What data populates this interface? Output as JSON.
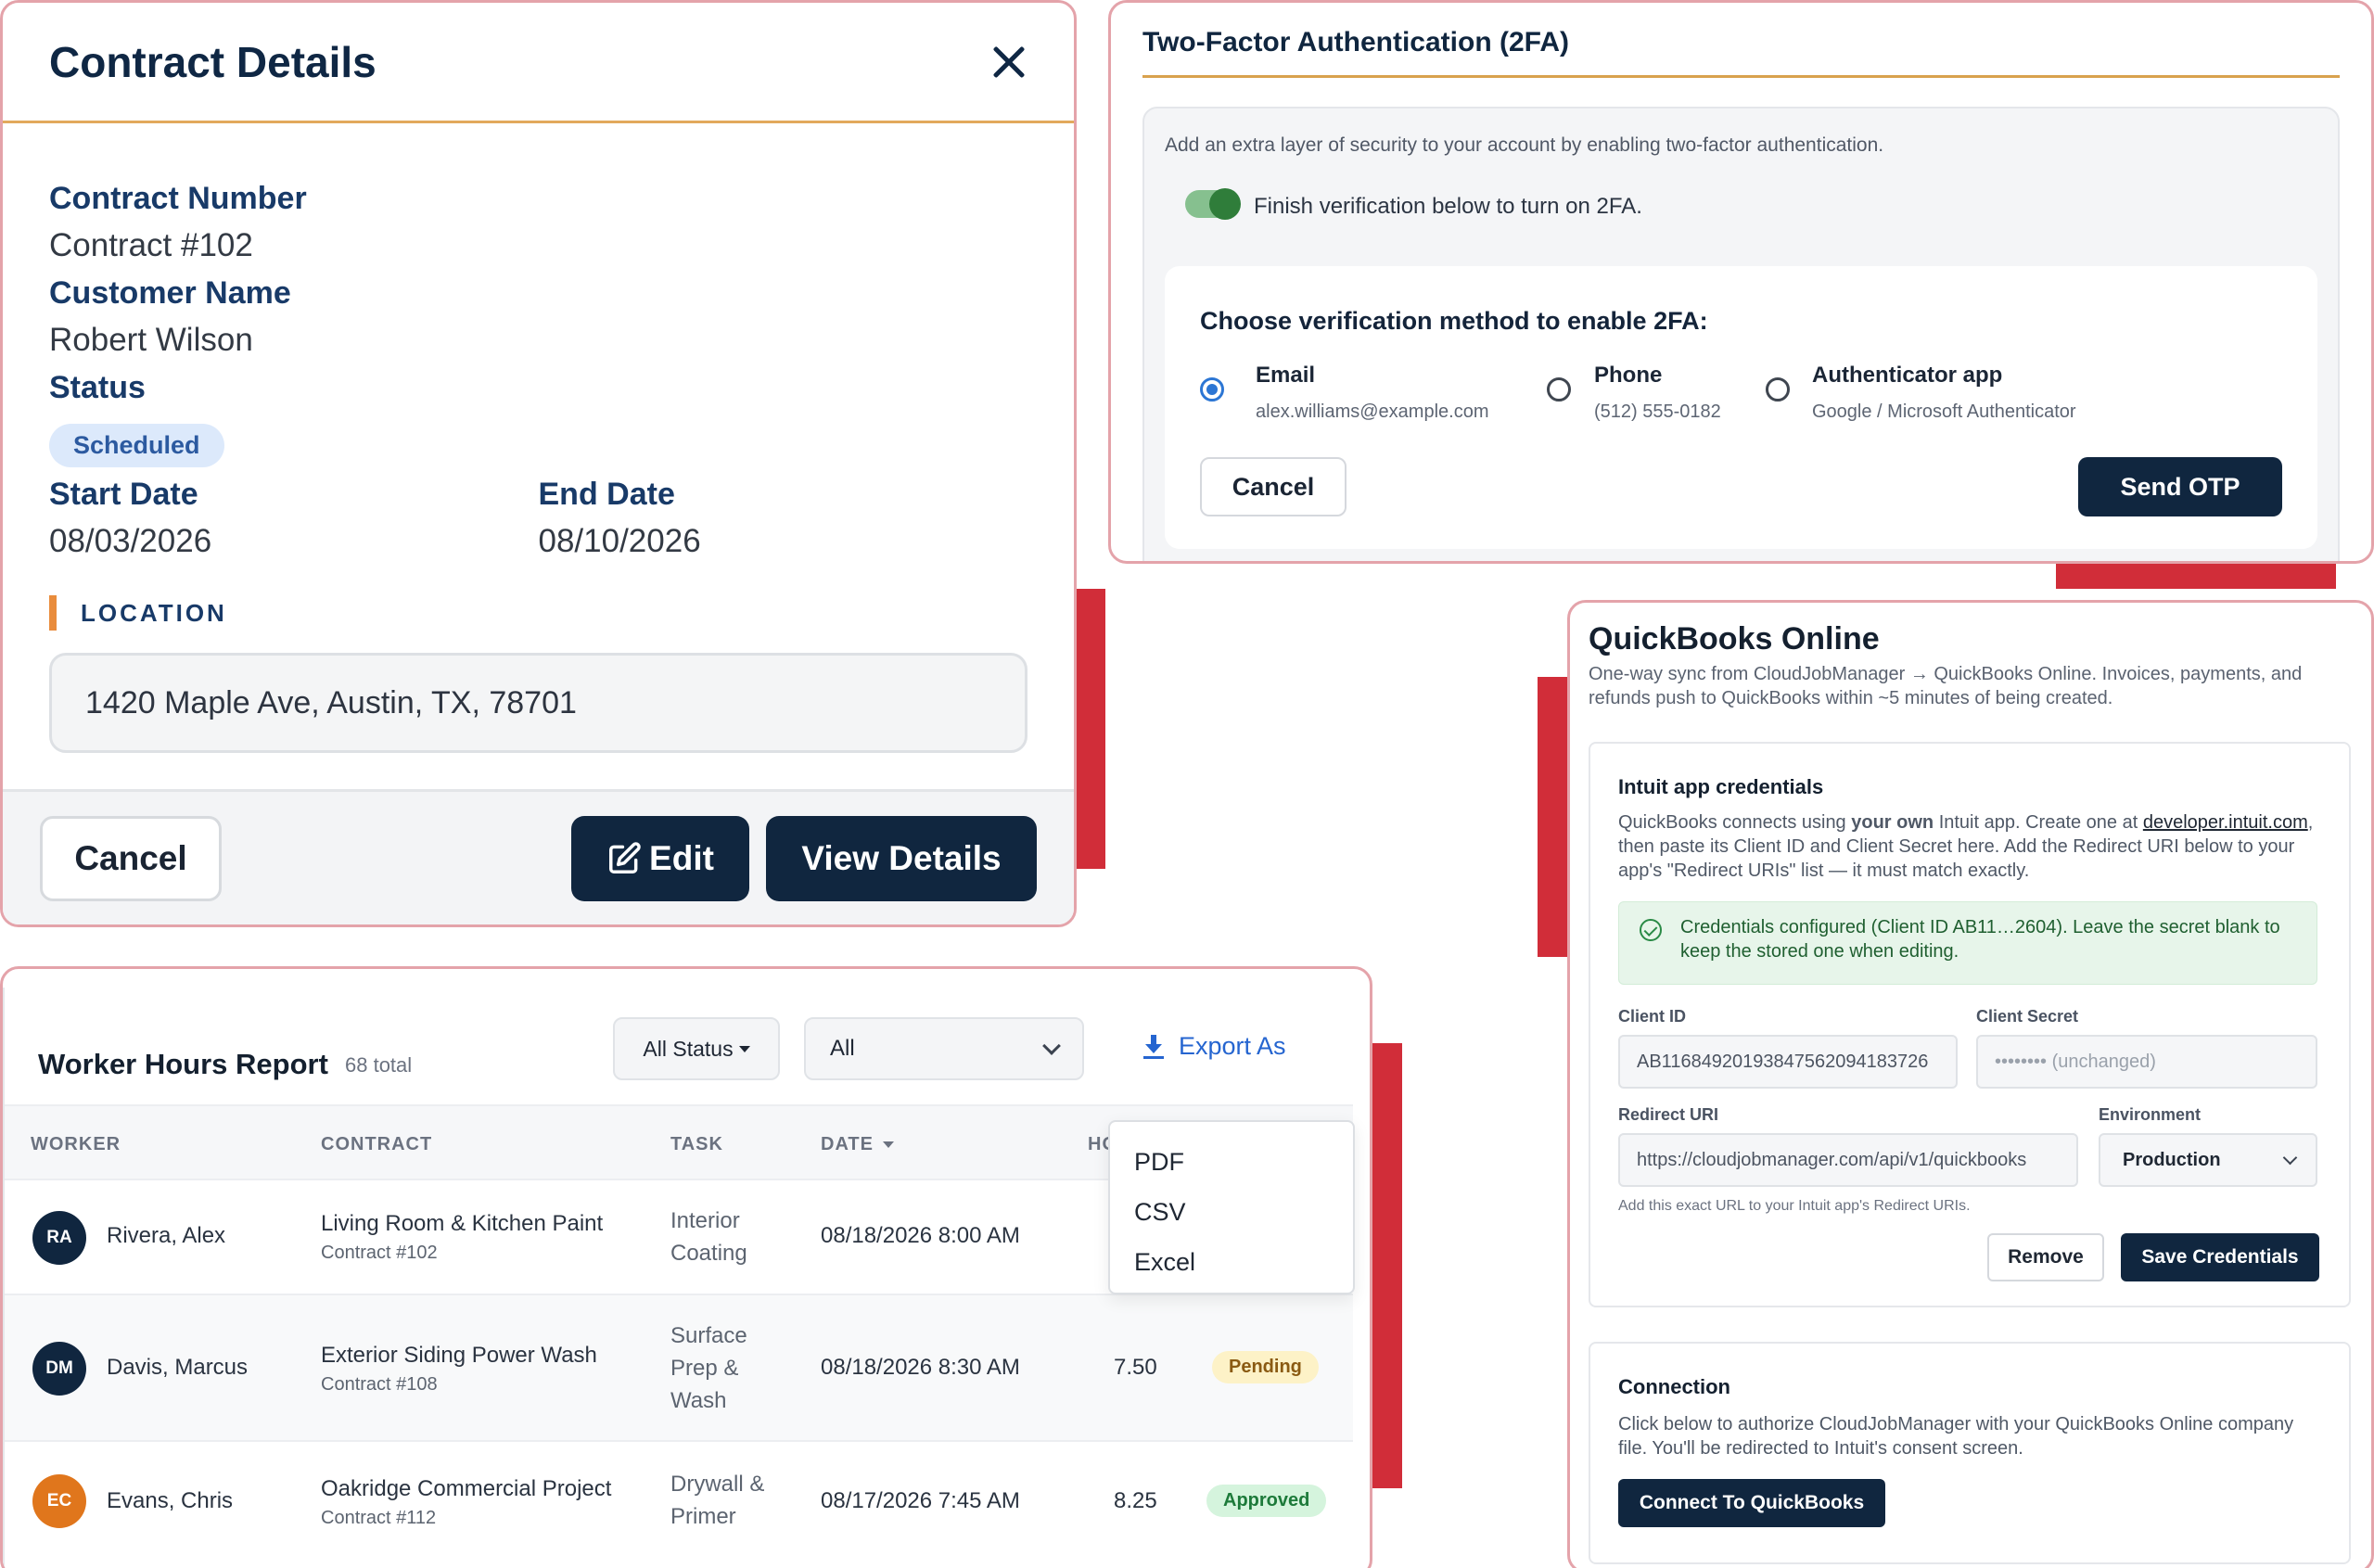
{
  "contract": {
    "title": "Contract Details",
    "contract_number_label": "Contract Number",
    "contract_number": "Contract #102",
    "customer_name_label": "Customer Name",
    "customer_name": "Robert Wilson",
    "status_label": "Status",
    "status": "Scheduled",
    "start_date_label": "Start Date",
    "start_date": "08/03/2026",
    "end_date_label": "End Date",
    "end_date": "08/10/2026",
    "location_label": "LOCATION",
    "location": "1420 Maple Ave, Austin, TX, 78701",
    "cancel_label": "Cancel",
    "edit_label": "Edit",
    "view_details_label": "View Details"
  },
  "twofa": {
    "title": "Two-Factor Authentication (2FA)",
    "description": "Add an extra layer of security to your account by enabling two-factor authentication.",
    "toggle_label": "Finish verification below to turn on 2FA.",
    "toggle_on": true,
    "choose_label": "Choose verification method to enable 2FA:",
    "options": [
      {
        "title": "Email",
        "sub": "alex.williams@example.com",
        "selected": true
      },
      {
        "title": "Phone",
        "sub": "(512) 555-0182",
        "selected": false
      },
      {
        "title": "Authenticator app",
        "sub": "Google / Microsoft Authenticator",
        "selected": false
      }
    ],
    "cancel_label": "Cancel",
    "send_label": "Send OTP"
  },
  "hours": {
    "title": "Worker Hours Report",
    "total": "68 total",
    "status_filter": "All Status",
    "all_filter": "All",
    "export_label": "Export As",
    "export_menu": [
      "PDF",
      "CSV",
      "Excel"
    ],
    "columns": {
      "worker": "WORKER",
      "contract": "CONTRACT",
      "task": "TASK",
      "date": "DATE",
      "hours": "HO"
    },
    "rows": [
      {
        "initials": "RA",
        "worker": "Rivera, Alex",
        "contract": "Living Room & Kitchen Paint",
        "contract_no": "Contract #102",
        "task": "Interior\nCoating",
        "date": "08/18/2026 8:00 AM",
        "hours": "",
        "status": ""
      },
      {
        "initials": "DM",
        "worker": "Davis, Marcus",
        "contract": "Exterior Siding Power Wash",
        "contract_no": "Contract #108",
        "task": "Surface\nPrep &\nWash",
        "date": "08/18/2026 8:30 AM",
        "hours": "7.50",
        "status": "Pending"
      },
      {
        "initials": "EC",
        "worker": "Evans, Chris",
        "contract": "Oakridge Commercial Project",
        "contract_no": "Contract #112",
        "task": "Drywall &\nPrimer",
        "date": "08/17/2026 7:45 AM",
        "hours": "8.25",
        "status": "Approved"
      }
    ],
    "avatar_colors": {
      "RA": "#10263f",
      "DM": "#10263f",
      "EC": "#e0761c"
    }
  },
  "quickbooks": {
    "title": "QuickBooks Online",
    "description": "One-way sync from CloudJobManager → QuickBooks Online. Invoices, payments, and refunds push to QuickBooks within ~5 minutes of being created.",
    "cred_title": "Intuit app credentials",
    "cred_desc_1": "QuickBooks connects using ",
    "cred_desc_bold": "your own",
    "cred_desc_2": " Intuit app. Create one at ",
    "cred_desc_link": "developer.intuit.com",
    "cred_desc_3": ", then paste its Client ID and Client Secret here. Add the Redirect URI below to your app's \"Redirect URIs\" list — it must match exactly.",
    "configured_msg": "Credentials configured (Client ID AB11…2604). Leave the secret blank to keep the stored one when editing.",
    "client_id_label": "Client ID",
    "client_id_value": "AB11684920193847562094183726",
    "client_secret_label": "Client Secret",
    "client_secret_placeholder": "•••••••• (unchanged)",
    "redirect_label": "Redirect URI",
    "redirect_value": "https://cloudjobmanager.com/api/v1/quickbooks",
    "environment_label": "Environment",
    "environment_value": "Production",
    "redirect_hint": "Add this exact URL to your Intuit app's Redirect URIs.",
    "remove_label": "Remove",
    "save_label": "Save Credentials",
    "connection_title": "Connection",
    "connection_desc": "Click below to authorize CloudJobManager with your QuickBooks Online company file. You'll be redirected to Intuit's consent screen.",
    "connect_label": "Connect To QuickBooks"
  }
}
